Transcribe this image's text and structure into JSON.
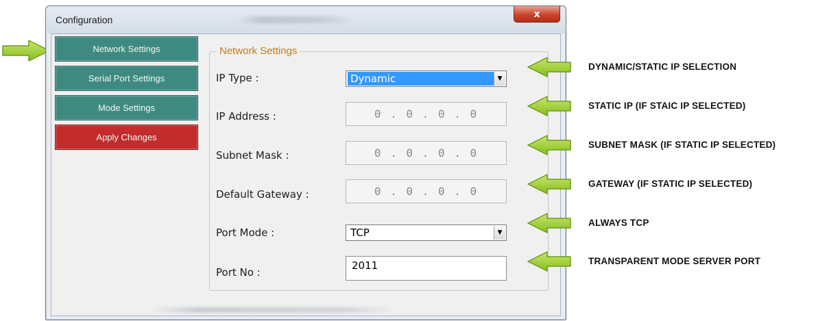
{
  "window": {
    "title": "Configuration",
    "close_label": "x"
  },
  "nav": {
    "items": [
      {
        "label": "Network Settings"
      },
      {
        "label": "Serial Port Settings"
      },
      {
        "label": "Mode Settings"
      },
      {
        "label": "Apply Changes"
      }
    ]
  },
  "group": {
    "title": "Network Settings"
  },
  "fields": {
    "ip_type": {
      "label": "IP Type :",
      "value": "Dynamic"
    },
    "ip_address": {
      "label": "IP Address :",
      "value": "0 . 0 . 0 . 0"
    },
    "subnet_mask": {
      "label": "Subnet Mask :",
      "value": "0 . 0 . 0 . 0"
    },
    "default_gateway": {
      "label": "Default Gateway :",
      "value": "0 . 0 . 0 . 0"
    },
    "port_mode": {
      "label": "Port Mode :",
      "value": "TCP"
    },
    "port_no": {
      "label": "Port No :",
      "value": "2011"
    }
  },
  "annotations": [
    "DYNAMIC/STATIC IP SELECTION",
    "STATIC IP (IF STAIC IP SELECTED)",
    "SUBNET MASK (IF STATIC IP SELECTED)",
    "GATEWAY (IF STATIC IP SELECTED)",
    "ALWAYS TCP",
    "TRANSPARENT MODE SERVER PORT"
  ],
  "colors": {
    "nav_button": "#3e8a80",
    "apply_button": "#c22c2c",
    "group_title": "#c47a1e",
    "annotation_arrow": "#9ccd2c",
    "selection": "#3399ff"
  }
}
